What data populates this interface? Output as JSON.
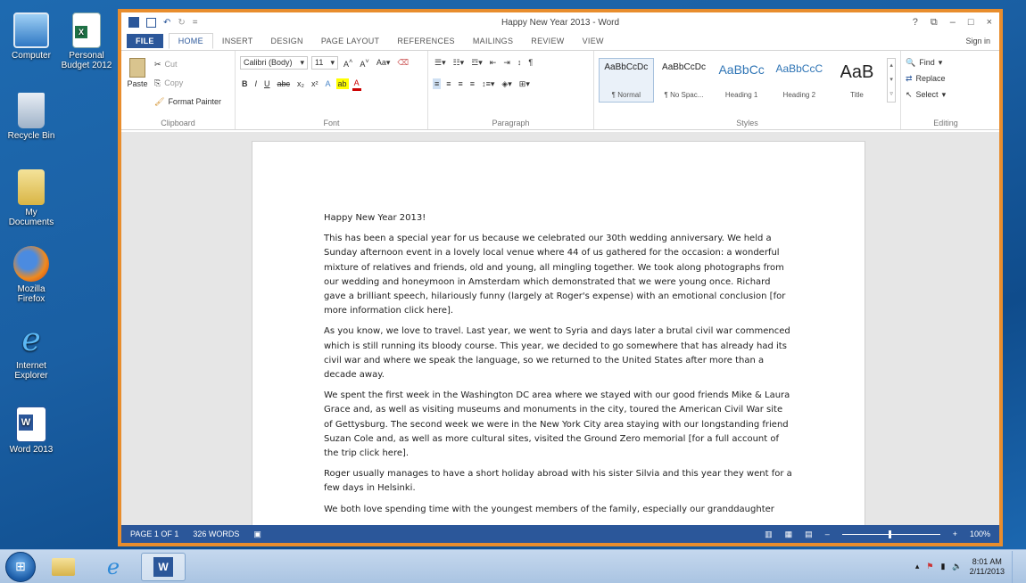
{
  "desktop": {
    "icons": [
      {
        "label": "Computer"
      },
      {
        "label": "Personal Budget 2012"
      },
      {
        "label": "Recycle Bin"
      },
      {
        "label": "My Documents"
      },
      {
        "label": "Mozilla Firefox"
      },
      {
        "label": "Internet Explorer"
      },
      {
        "label": "Word 2013"
      }
    ]
  },
  "window": {
    "title": "Happy New Year 2013 - Word",
    "controls": {
      "help": "?",
      "minimize": "–",
      "maximize": "□",
      "close": "×"
    },
    "sign_in": "Sign in"
  },
  "tabs": [
    "FILE",
    "HOME",
    "INSERT",
    "DESIGN",
    "PAGE LAYOUT",
    "REFERENCES",
    "MAILINGS",
    "REVIEW",
    "VIEW"
  ],
  "ribbon": {
    "clipboard": {
      "paste": "Paste",
      "cut": "Cut",
      "copy": "Copy",
      "format_painter": "Format Painter",
      "label": "Clipboard"
    },
    "font": {
      "name": "Calibri (Body)",
      "size": "11",
      "label": "Font"
    },
    "paragraph": {
      "label": "Paragraph"
    },
    "styles": {
      "label": "Styles",
      "items": [
        {
          "sample": "AaBbCcDc",
          "name": "¶ Normal"
        },
        {
          "sample": "AaBbCcDc",
          "name": "¶ No Spac..."
        },
        {
          "sample": "AaBbCc",
          "name": "Heading 1"
        },
        {
          "sample": "AaBbCcC",
          "name": "Heading 2"
        },
        {
          "sample": "AaB",
          "name": "Title"
        }
      ]
    },
    "editing": {
      "find": "Find",
      "replace": "Replace",
      "select": "Select",
      "label": "Editing"
    }
  },
  "document": {
    "heading": "Happy New Year 2013!",
    "paragraphs": [
      "This has been a special year for us because we celebrated our 30th wedding anniversary. We held a Sunday afternoon event in a lovely local venue where 44 of us gathered for the occasion: a wonderful mixture of relatives and friends, old and young, all mingling together. We took along photographs from our wedding and honeymoon in Amsterdam which demonstrated that we were young once. Richard gave a brilliant speech, hilariously funny (largely at Roger's expense) with an emotional conclusion [for more information click here].",
      "As you know, we love to travel. Last year, we went to Syria and days later a brutal civil war commenced which is still running its bloody course. This year, we decided to go somewhere that has already had its civil war and where we speak the language, so we returned to the United States after more than a decade away.",
      "We spent the first week in the Washington DC area where we stayed with our good friends Mike & Laura Grace and, as well as visiting museums and monuments in the city, toured the American Civil War site of Gettysburg. The second week we were in the New York City area staying with our longstanding friend Suzan Cole and, as well as more cultural sites, visited the Ground Zero memorial [for a full account of the trip click here].",
      "Roger usually manages to have a short holiday abroad with his sister Silvia and this year they went for a few days in Helsinki.",
      "We both love spending time with the youngest members of the family, especially our granddaughter"
    ]
  },
  "status": {
    "page": "PAGE 1 OF 1",
    "words": "326 WORDS",
    "zoom": "100%",
    "zoom_minus": "–",
    "zoom_plus": "+"
  },
  "taskbar": {
    "time": "8:01 AM",
    "date": "2/11/2013"
  }
}
